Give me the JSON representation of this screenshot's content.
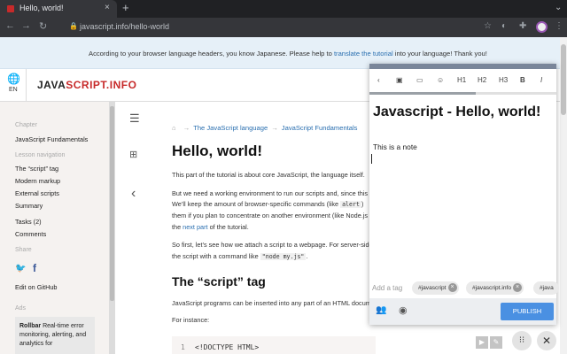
{
  "browser": {
    "tab_title": "Hello, world!",
    "tab_close": "×",
    "new_tab": "+",
    "url": "javascript.info/hello-world"
  },
  "banner": {
    "text_before": "According to your browser language headers, you know Japanese. Please help to ",
    "link": "translate the tutorial",
    "text_after": " into your language! Thank you!"
  },
  "header": {
    "lang": "EN",
    "logo_a": "JAVA",
    "logo_b": "SCRIPT.INFO"
  },
  "sidebar": {
    "chapter_heading": "Chapter",
    "chapter": "JavaScript Fundamentals",
    "nav_heading": "Lesson navigation",
    "nav_items": [
      "The “script” tag",
      "Modern markup",
      "External scripts",
      "Summary"
    ],
    "tasks": "Tasks (2)",
    "comments": "Comments",
    "share_heading": "Share",
    "edit_github": "Edit on GitHub",
    "ads_heading": "Ads",
    "ad_brand": "Rollbar",
    "ad_text": " Real-time error monitoring, alerting, and analytics for"
  },
  "article": {
    "crumb1": "The JavaScript language",
    "crumb2": "JavaScript Fundamentals",
    "title": "Hello, world!",
    "p1": "This part of the tutorial is about core JavaScript, the language itself.",
    "p2_l1": "But we need a working environment to run our scripts and, since this",
    "p2_l2a": "We’ll keep the amount of browser-specific commands (like ",
    "p2_code": "alert",
    "p2_l2b": ")",
    "p2_l3": "them if you plan to concentrate on another environment (like Node.js",
    "p2_l4a": "the ",
    "p2_link": "next part",
    "p2_l4b": " of the tutorial.",
    "p3_l1": "So first, let’s see how we attach a script to a webpage. For server-side",
    "p3_l2a": "the script with a command like ",
    "p3_code": "\"node my.js\"",
    "p3_l2b": ".",
    "h2": "The “script” tag",
    "p4": "JavaScript programs can be inserted into any part of an HTML docum",
    "p5": "For instance:",
    "code_line_no": "1",
    "code_line": "<!DOCTYPE HTML>"
  },
  "note": {
    "tools": [
      "H1",
      "H2",
      "H3",
      "B",
      "I"
    ],
    "title": "Javascript - Hello, world!",
    "body": "This is a note",
    "add_tag_placeholder": "Add a tag",
    "tags": [
      "#javascript",
      "#javascript.info",
      "#java"
    ],
    "publish": "PUBLISH"
  },
  "colors": {
    "accent": "#c72a2a",
    "link": "#2a6fb0",
    "publish": "#4a90e2"
  }
}
